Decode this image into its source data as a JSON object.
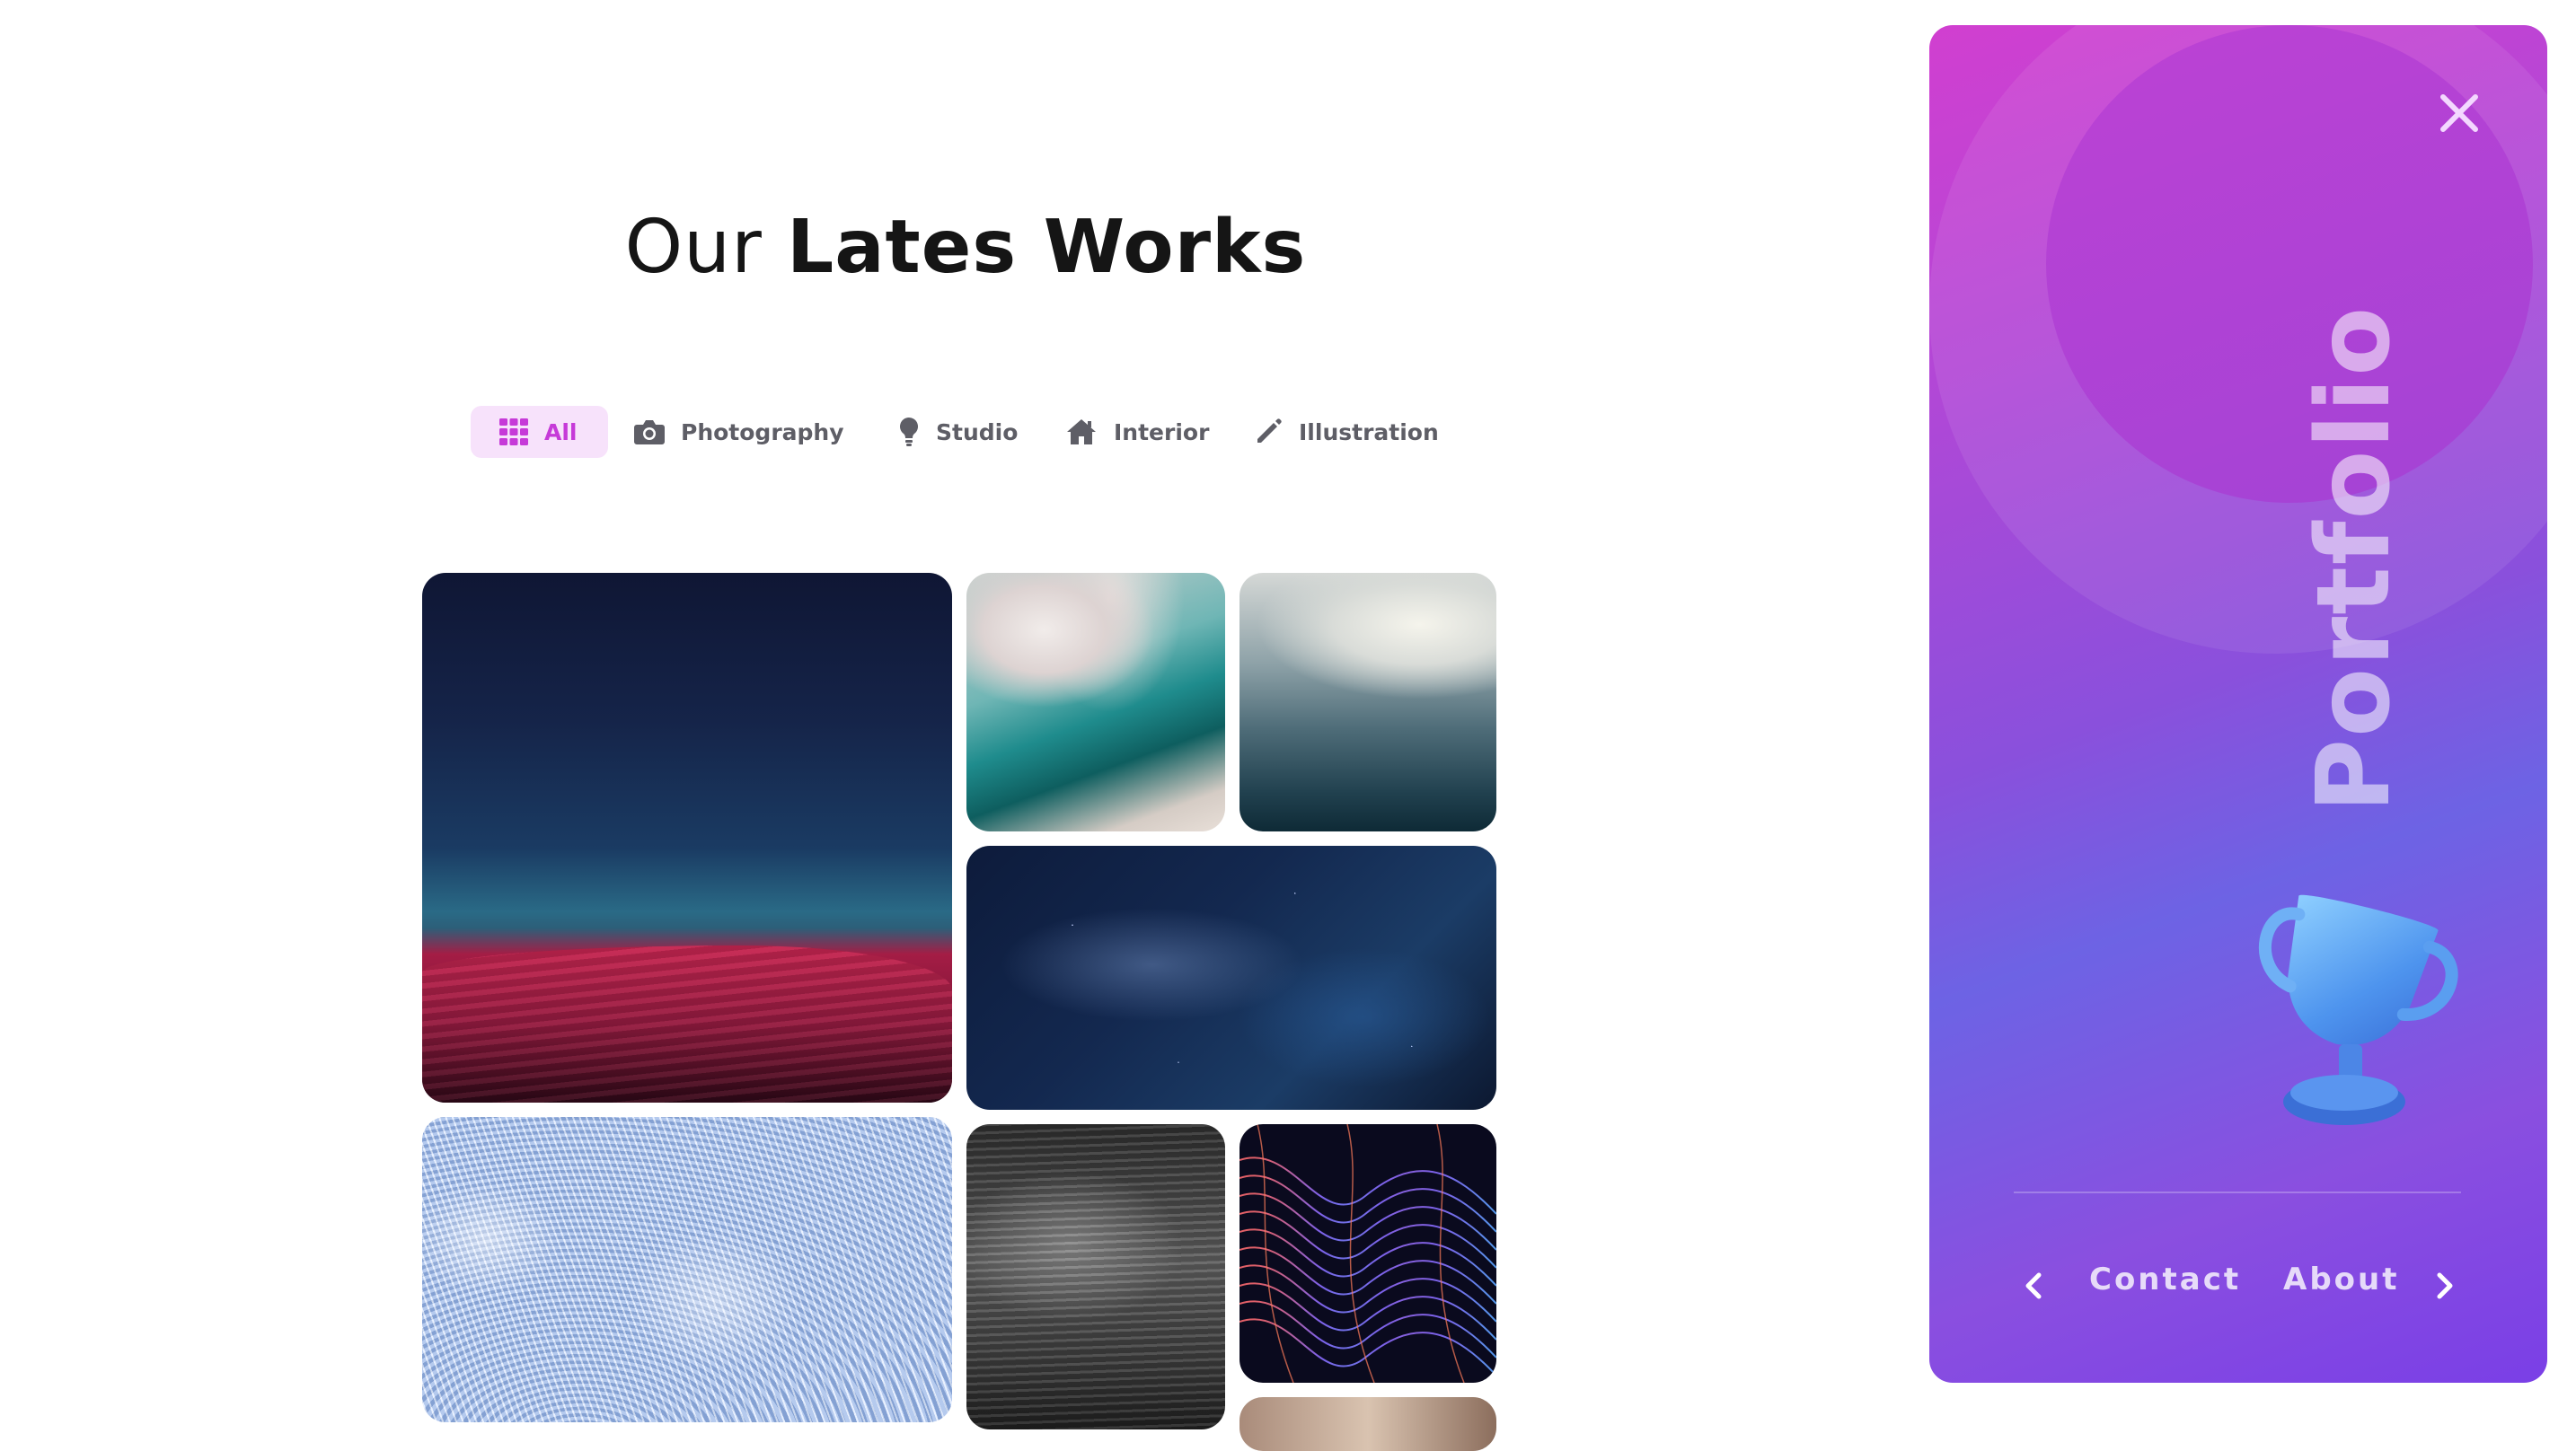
{
  "heading": {
    "light": "Our",
    "bold": "Lates Works"
  },
  "filters": [
    {
      "label": "All",
      "icon": "grid-icon",
      "active": true
    },
    {
      "label": "Photography",
      "icon": "camera-icon",
      "active": false
    },
    {
      "label": "Studio",
      "icon": "lightbulb-icon",
      "active": false
    },
    {
      "label": "Interior",
      "icon": "home-icon",
      "active": false
    },
    {
      "label": "Illustration",
      "icon": "pencil-icon",
      "active": false
    }
  ],
  "gallery": [
    {
      "name": "desert-night"
    },
    {
      "name": "teal-wave"
    },
    {
      "name": "misty-fog"
    },
    {
      "name": "deep-space"
    },
    {
      "name": "white-feathers"
    },
    {
      "name": "gray-smoke"
    },
    {
      "name": "light-waves"
    },
    {
      "name": "partial-image"
    }
  ],
  "panel": {
    "title": "Portfolio",
    "nav": {
      "prev_icon": "chevron-left-icon",
      "contact": "Contact",
      "about": "About",
      "next_icon": "chevron-right-icon"
    },
    "close_icon": "close-icon",
    "decor_icon": "trophy-icon"
  },
  "colors": {
    "accent": "#c63ad8",
    "accent_bg": "#f7e2fb",
    "panel_gradient_start": "#d13fd0",
    "panel_gradient_end": "#7a3fe6"
  }
}
